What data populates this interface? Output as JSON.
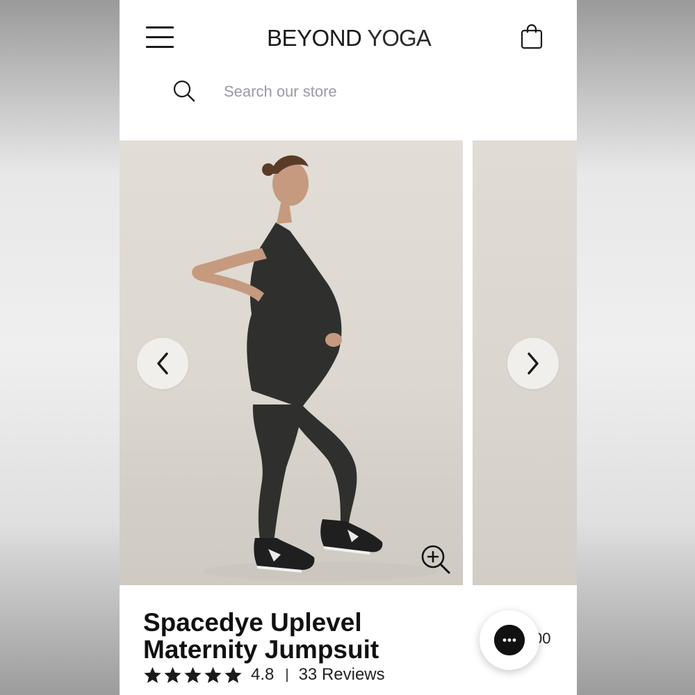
{
  "header": {
    "brand_primary": "BEYOND",
    "brand_secondary": "YOGA",
    "menu_icon": "hamburger-menu-icon",
    "cart_icon": "shopping-bag-icon"
  },
  "search": {
    "placeholder": "Search our store",
    "icon": "search-icon"
  },
  "gallery": {
    "prev_icon": "chevron-left-icon",
    "next_icon": "chevron-right-icon",
    "zoom_icon": "zoom-in-icon"
  },
  "product": {
    "title": "Spacedye Uplevel Maternity Jumpsuit",
    "rating_value": "4.8",
    "rating_stars": 5,
    "separator": "|",
    "reviews_label": "33 Reviews",
    "price_partial": "00"
  },
  "chat": {
    "icon": "chat-bubble-icon"
  },
  "colors": {
    "text": "#1a1a1a",
    "placeholder": "#9a9aa6",
    "photo_background": "#dcd7cf",
    "garment": "#2f302d",
    "nav_button": "#f1efec"
  }
}
